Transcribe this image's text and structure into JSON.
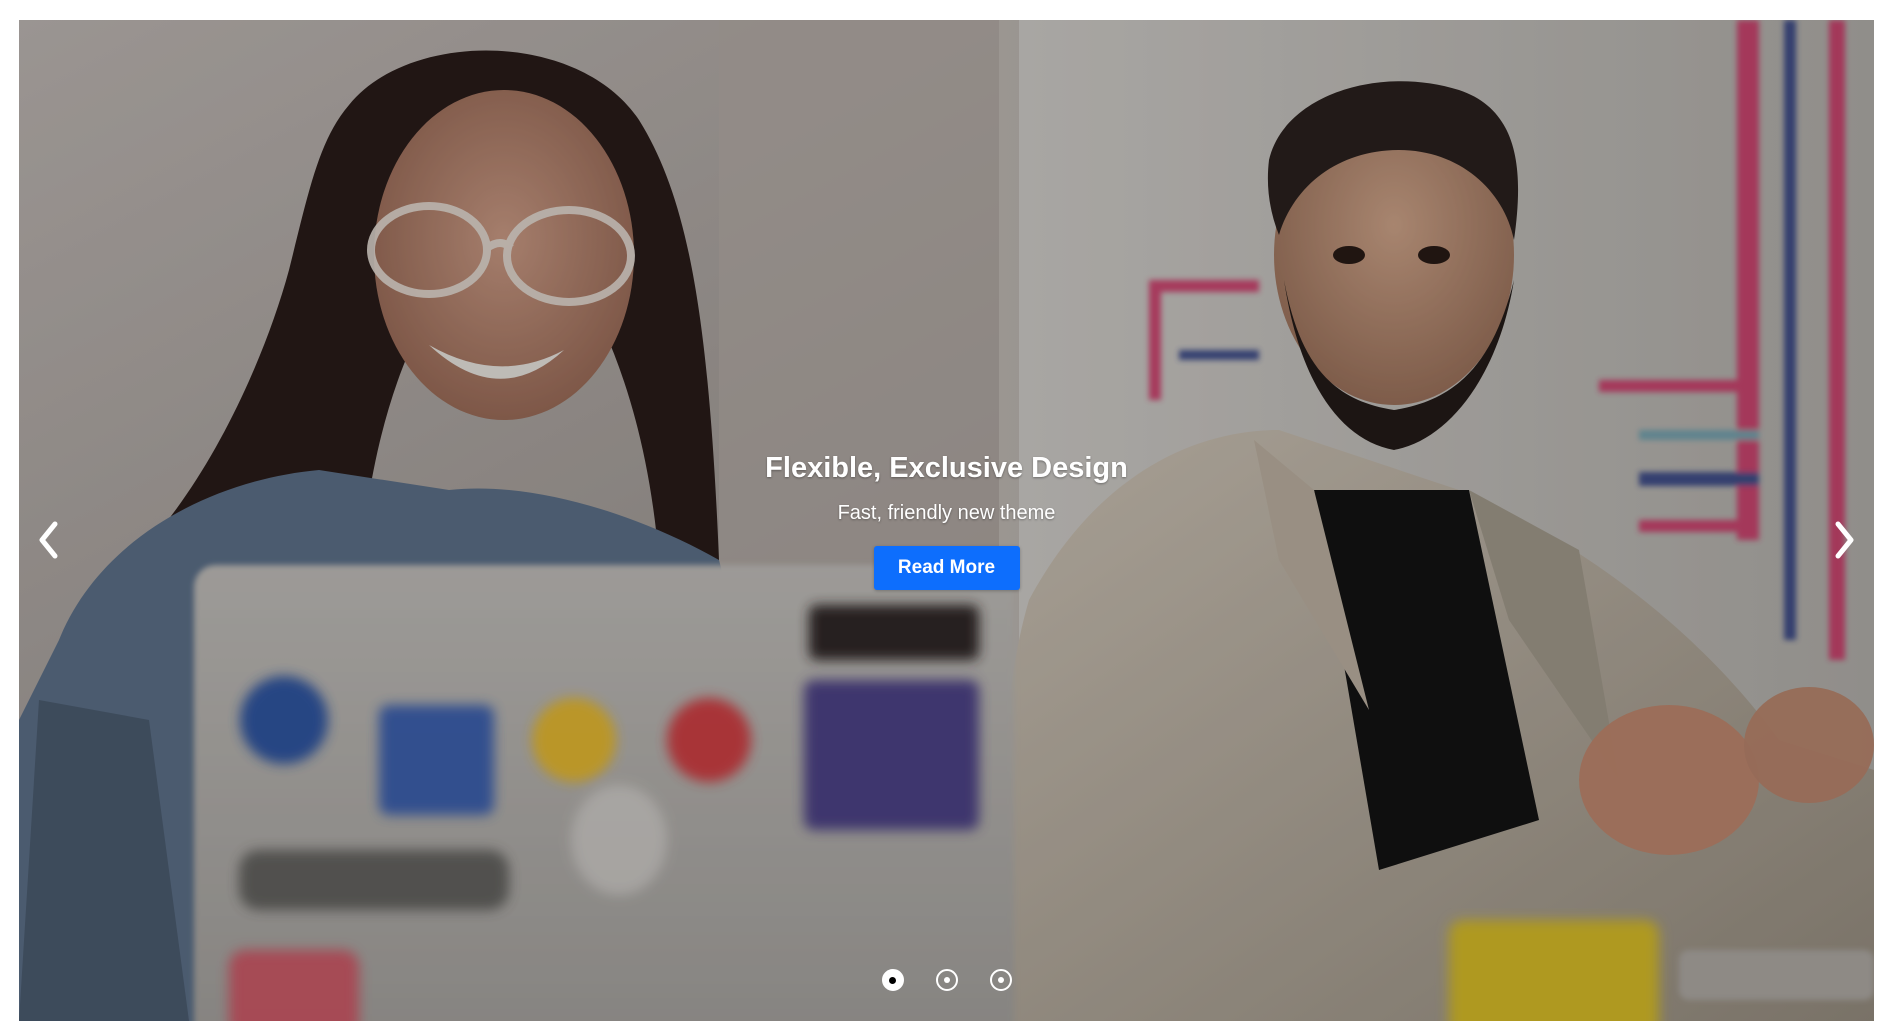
{
  "slider": {
    "title": "Flexible, Exclusive Design",
    "subtitle": "Fast, friendly new theme",
    "button_label": "Read More",
    "prev_icon": "chevron-left-icon",
    "next_icon": "chevron-right-icon",
    "indicators": [
      {
        "state": "active"
      },
      {
        "state": "inactive"
      },
      {
        "state": "inactive"
      }
    ],
    "colors": {
      "button": "#0d6efd",
      "text": "#ffffff"
    }
  }
}
